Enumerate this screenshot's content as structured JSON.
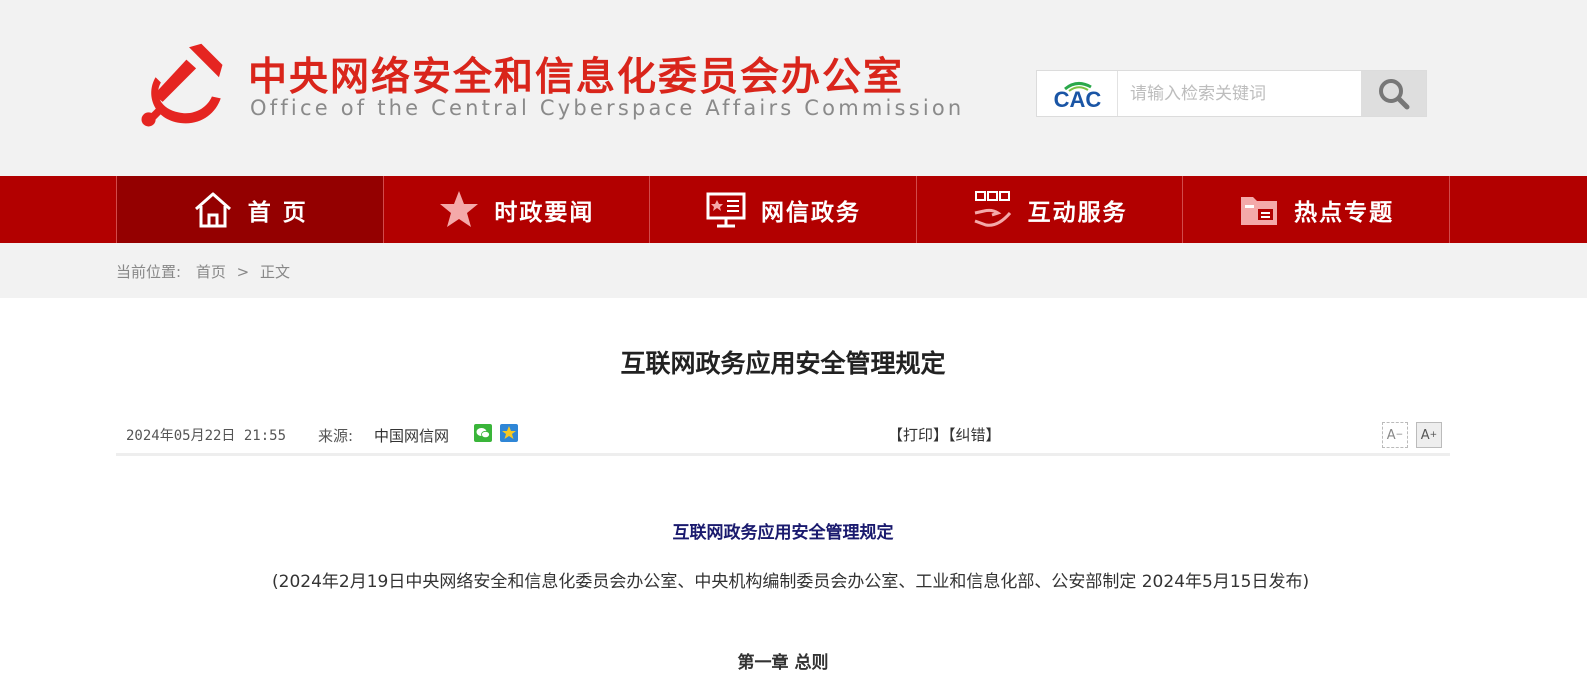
{
  "header": {
    "site_title_cn": "中央网络安全和信息化委员会办公室",
    "site_title_en": "Office of the Central Cyberspace Affairs Commission",
    "cac_logo_text": "CAC",
    "search_placeholder": "请输入检索关键词"
  },
  "nav": {
    "items": [
      {
        "label": "首 页",
        "icon": "home-icon"
      },
      {
        "label": "时政要闻",
        "icon": "star-icon"
      },
      {
        "label": "网信政务",
        "icon": "monitor-icon"
      },
      {
        "label": "互动服务",
        "icon": "hand-service-icon"
      },
      {
        "label": "热点专题",
        "icon": "folder-icon"
      }
    ]
  },
  "breadcrumb": {
    "label": "当前位置:",
    "home": "首页",
    "separator": ">",
    "current": "正文"
  },
  "article": {
    "title": "互联网政务应用安全管理规定",
    "date": "2024年05月22日 21:55",
    "source_label": "来源:",
    "source": "中国网信网",
    "print": "【打印】",
    "correct": "【纠错】",
    "font_decrease": "A",
    "font_increase": "A",
    "body_title": "互联网政务应用安全管理规定",
    "body_paragraph": "(2024年2月19日中央网络安全和信息化委员会办公室、中央机构编制委员会办公室、工业和信息化部、公安部制定  2024年5月15日发布)",
    "next_heading": "第一章 总则"
  },
  "colors": {
    "brand_red": "#d9251b",
    "nav_red": "#b20000",
    "nav_active": "#940000",
    "body_title": "#1a1a6e"
  }
}
